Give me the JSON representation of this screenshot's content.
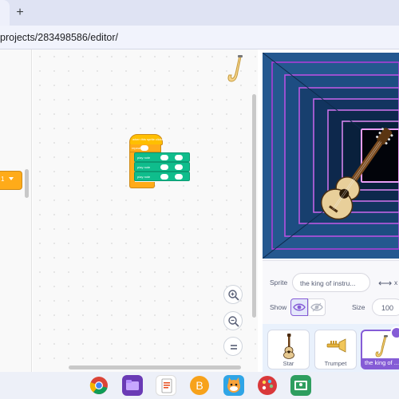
{
  "browser": {
    "new_tab_symbol": "+",
    "url": "projects/283498586/editor/"
  },
  "palette": {
    "block_value": "1"
  },
  "script": {
    "hat_text": "when this sprite clicked",
    "repeat_label": "repeat",
    "repeat_value": "10",
    "note_blocks": [
      {
        "label": "play note"
      },
      {
        "label": "play note"
      },
      {
        "label": "play note"
      }
    ]
  },
  "zoom": {
    "zoom_in": "zoom-in-icon",
    "zoom_out": "zoom-out-icon",
    "reset": "zoom-reset-icon"
  },
  "sprite_info": {
    "sprite_label": "Sprite",
    "sprite_name": "the king of instru...",
    "x_label": "x",
    "show_label": "Show",
    "size_label": "Size",
    "size_value": "100"
  },
  "sprites": [
    {
      "name": "Star",
      "icon": "guitar-icon",
      "selected": false
    },
    {
      "name": "Trumpet",
      "icon": "trumpet-icon",
      "selected": false
    },
    {
      "name": "the king of ...",
      "icon": "saxophone-icon",
      "selected": true
    }
  ],
  "taskbar": [
    {
      "name": "chrome-icon"
    },
    {
      "name": "files-icon"
    },
    {
      "name": "docs-icon"
    },
    {
      "name": "bitcoin-app-icon"
    },
    {
      "name": "scratch-cat-icon"
    },
    {
      "name": "paint-icon"
    },
    {
      "name": "classroom-icon"
    }
  ],
  "colors": {
    "motion_accent": "#855cd6",
    "events": "#ffbf00",
    "control": "#ffab19",
    "music": "#0fbd8c"
  }
}
